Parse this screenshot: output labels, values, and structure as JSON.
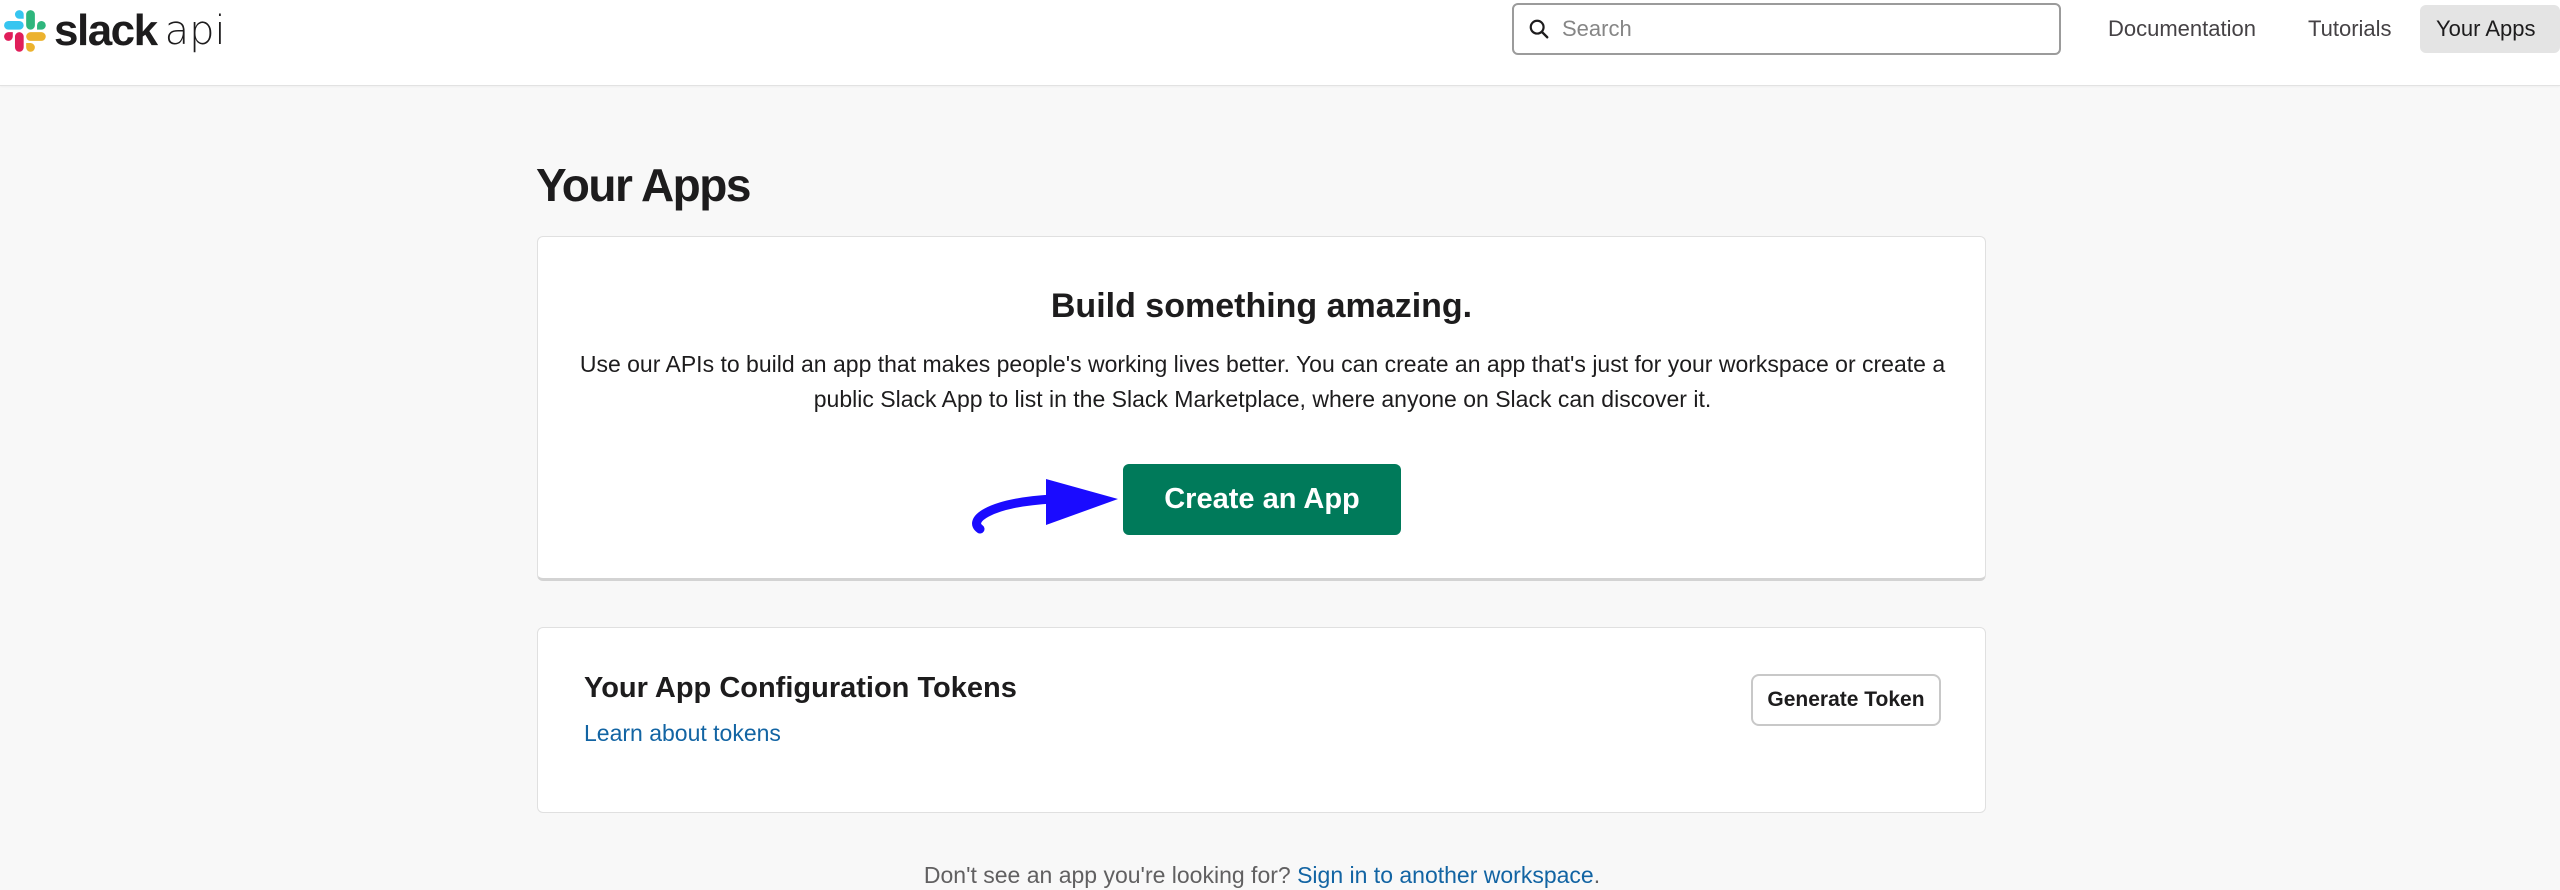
{
  "header": {
    "logo_wordmark": "slack",
    "logo_suffix": "api",
    "search": {
      "placeholder": "Search",
      "value": ""
    },
    "nav": [
      {
        "label": "Documentation",
        "active": false
      },
      {
        "label": "Tutorials",
        "active": false
      },
      {
        "label": "Your Apps",
        "active": true
      }
    ]
  },
  "main": {
    "page_title": "Your Apps",
    "hero": {
      "title": "Build something amazing.",
      "description": "Use our APIs to build an app that makes people's working lives better. You can create an app that's just for your workspace or create a public Slack App to list in the Slack Marketplace, where anyone on Slack can discover it.",
      "cta_label": "Create an App"
    },
    "tokens": {
      "title": "Your App Configuration Tokens",
      "link_label": "Learn about tokens",
      "button_label": "Generate Token"
    },
    "footer": {
      "text": "Don't see an app you're looking for?",
      "link_label": "Sign in to another workspace",
      "suffix": "."
    }
  },
  "icons": {
    "logo": "slack-logo-icon",
    "search": "search-icon",
    "annotation": "arrow-annotation-icon"
  },
  "colors": {
    "primary_button": "#007a5a",
    "link": "#1264a3",
    "annotation_arrow": "#1a0bff",
    "background": "#f8f8f8"
  }
}
